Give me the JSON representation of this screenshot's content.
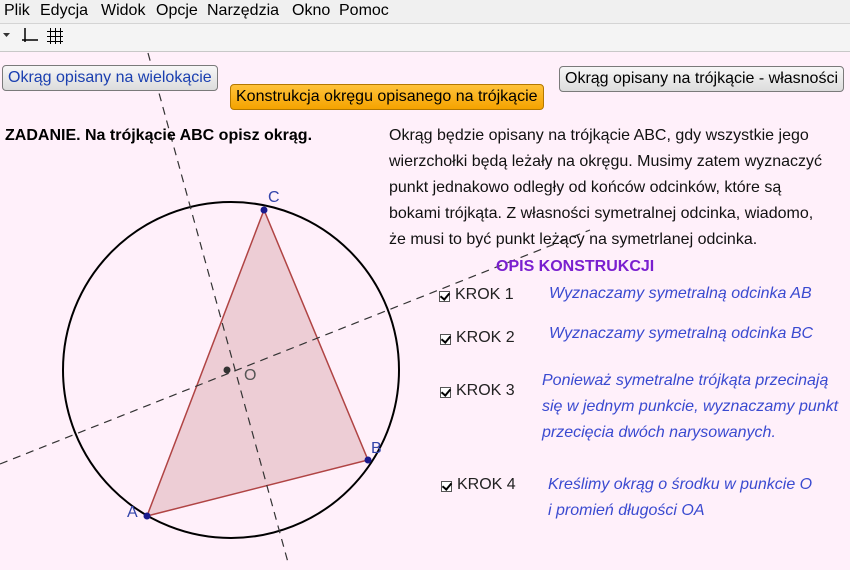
{
  "menu": [
    "Plik",
    "Edycja",
    "Widok",
    "Opcje",
    "Narzędzia",
    "Okno",
    "Pomoc"
  ],
  "toolbar": {
    "icons": [
      "dropdown-arrow-icon",
      "axes-icon",
      "grid-icon"
    ]
  },
  "buttons": {
    "polygon": "Okrąg opisany na wielokącie",
    "construction": "Konstrukcja okręgu opisanego na trójkącie",
    "properties": "Okrąg opisany na trójkącie - własności"
  },
  "task": "ZADANIE. Na trójkącie ABC opisz okrąg.",
  "description": [
    "Okrąg będzie opisany na trójkącie ABC, gdy wszystkie jego",
    "wierzchołki będą leżały na okręgu. Musimy zatem wyznaczyć",
    "punkt jednakowo odległy od końców odcinków, które są",
    "bokami trójkąta. Z własności symetralnej odcinka, wiadomo,",
    "że musi to być punkt leżący na symetrlanej odcinka."
  ],
  "opis_title": "OPIS KONSTRUKCJI",
  "steps": [
    {
      "label": "KROK 1",
      "checked": true,
      "text": [
        "Wyznaczamy symetralną odcinka AB"
      ]
    },
    {
      "label": "KROK 2",
      "checked": true,
      "text": [
        "Wyznaczamy symetralną odcinka BC"
      ]
    },
    {
      "label": "KROK 3",
      "checked": true,
      "text": [
        "Ponieważ symetralne trójkąta przecinają",
        "się w jednym punkcie, wyznaczamy punkt",
        "przecięcia dwóch narysowanych."
      ]
    },
    {
      "label": "KROK 4",
      "checked": true,
      "text": [
        "Kreślimy okrąg o środku w punkcie O",
        "i promień długości OA"
      ]
    }
  ],
  "points": {
    "A": "A",
    "B": "B",
    "C": "C",
    "O": "O"
  },
  "colors": {
    "triangle_fill": "#e8c4cc",
    "triangle_stroke": "#b04444",
    "point": "#1a1a8c",
    "label": "#3344aa",
    "center": "#333333"
  }
}
